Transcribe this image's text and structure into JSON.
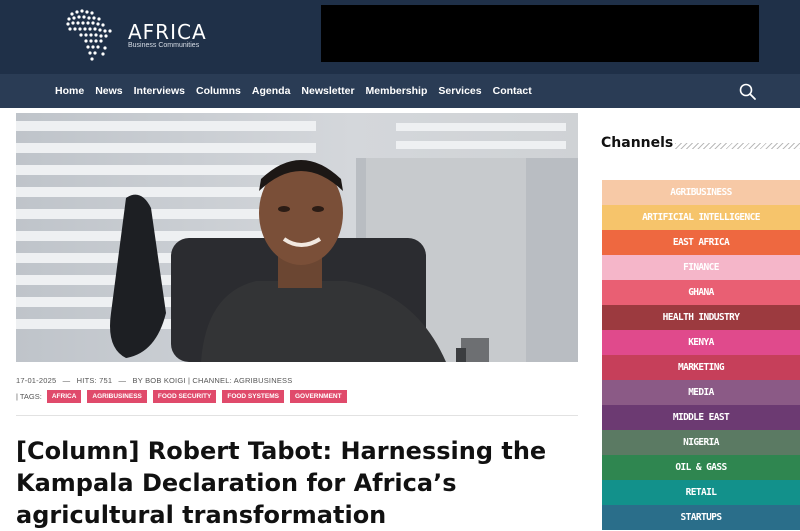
{
  "header": {
    "logo_name": "AFRICA",
    "logo_sub": "Business Communities"
  },
  "nav": {
    "items": [
      "Home",
      "News",
      "Interviews",
      "Columns",
      "Agenda",
      "Newsletter",
      "Membership",
      "Services",
      "Contact"
    ]
  },
  "icons": {
    "search": "search-icon"
  },
  "article": {
    "date": "17-01-2025",
    "hits": "HITS: 751",
    "byline": "BY BOB KOIGI | CHANNEL: AGRIBUSINESS",
    "tags_label": "| TAGS:",
    "tags": [
      "AFRICA",
      "AGRIBUSINESS",
      "FOOD SECURITY",
      "FOOD SYSTEMS",
      "GOVERNMENT"
    ],
    "title": "[Column] Robert Tabot: Harnessing the Kampala Declaration for Africa’s agricultural transformation"
  },
  "sidebar": {
    "title": "Channels",
    "channels": [
      {
        "label": "AGRIBUSINESS",
        "color": "#f7c9a6"
      },
      {
        "label": "ARTIFICIAL INTELLIGENCE",
        "color": "#f6c46b"
      },
      {
        "label": "EAST AFRICA",
        "color": "#ee6840"
      },
      {
        "label": "FINANCE",
        "color": "#f5b6c9"
      },
      {
        "label": "GHANA",
        "color": "#e95f73"
      },
      {
        "label": "HEALTH INDUSTRY",
        "color": "#9c3a3f"
      },
      {
        "label": "KENYA",
        "color": "#e04a8c"
      },
      {
        "label": "MARKETING",
        "color": "#c63f5a"
      },
      {
        "label": "MEDIA",
        "color": "#8b5a86"
      },
      {
        "label": "MIDDLE EAST",
        "color": "#6c3a72"
      },
      {
        "label": "NIGERIA",
        "color": "#5b7a63"
      },
      {
        "label": "OIL & GASS",
        "color": "#2f8650"
      },
      {
        "label": "RETAIL",
        "color": "#12918b"
      },
      {
        "label": "STARTUPS",
        "color": "#2a6e8a"
      }
    ]
  },
  "colors": {
    "topbar": "#1f3048",
    "navbar": "#2a3c55",
    "tag": "#e04a6b"
  }
}
